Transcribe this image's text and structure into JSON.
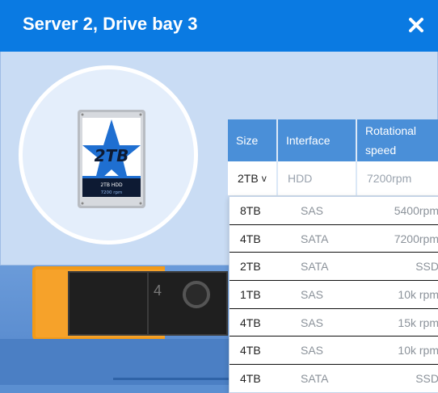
{
  "dialog": {
    "title": "Server 2, Drive bay 3",
    "close_icon": "close-icon"
  },
  "background": {
    "bay_number": "4"
  },
  "drive_image": {
    "icon": "hard-drive-icon",
    "size_label": "2TB",
    "model_label": "2TB HDD",
    "rpm_label": "7200 rpm"
  },
  "spec_table": {
    "headers": {
      "size": "Size",
      "interface": "Interface",
      "speed": "Rotational speed"
    },
    "current": {
      "size": "2TB",
      "interface": "HDD",
      "speed": "7200rpm"
    },
    "caret": "v"
  },
  "dropdown": {
    "options": [
      {
        "size": "8TB",
        "interface": "SAS",
        "speed": "5400rpm"
      },
      {
        "size": "4TB",
        "interface": "SATA",
        "speed": "7200rpm"
      },
      {
        "size": "2TB",
        "interface": "SATA",
        "speed": "SSD"
      },
      {
        "size": "1TB",
        "interface": "SAS",
        "speed": "10k rpm"
      },
      {
        "size": "4TB",
        "interface": "SAS",
        "speed": "15k rpm"
      },
      {
        "size": "4TB",
        "interface": "SAS",
        "speed": "10k rpm"
      },
      {
        "size": "4TB",
        "interface": "SATA",
        "speed": "SSD"
      }
    ]
  },
  "colors": {
    "header_blue": "#0a7ae2",
    "table_header": "#4a8fd8",
    "panel_bg": "#c9dcf4",
    "bezel_orange": "#f39a17"
  }
}
